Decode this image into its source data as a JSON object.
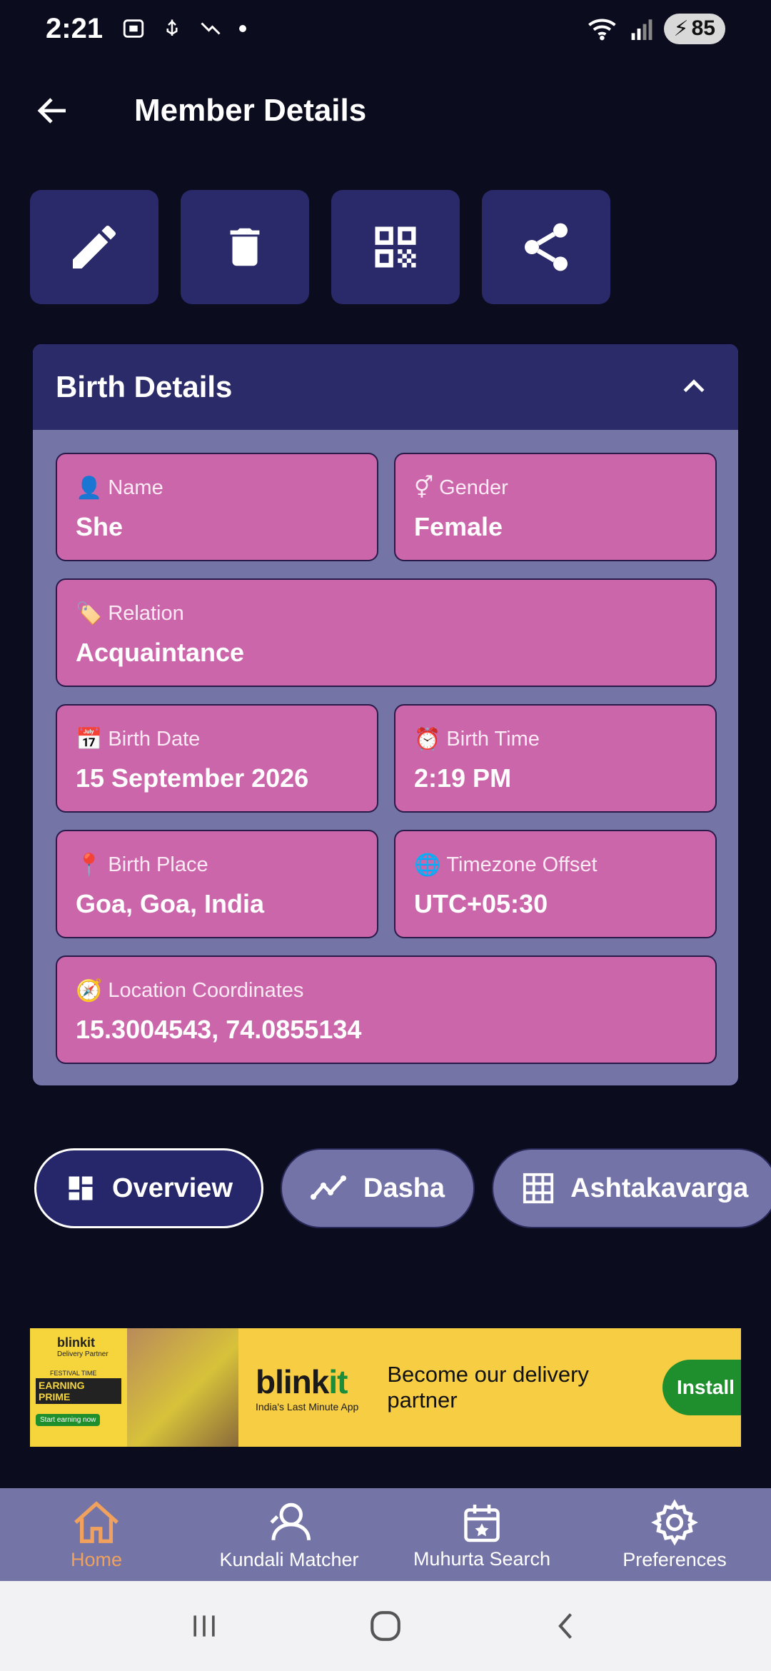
{
  "status_bar": {
    "time": "2:21",
    "battery": "85",
    "wifi_label": "5"
  },
  "header": {
    "title": "Member Details"
  },
  "actions": {
    "edit_icon": "pencil-icon",
    "delete_icon": "trash-icon",
    "qr_icon": "qr-code-icon",
    "share_icon": "share-icon"
  },
  "birth_details": {
    "title": "Birth Details",
    "fields": {
      "name": {
        "emoji": "👤",
        "label": "Name",
        "value": "She"
      },
      "gender": {
        "emoji": "⚥",
        "label": "Gender",
        "value": "Female"
      },
      "relation": {
        "emoji": "🏷️",
        "label": "Relation",
        "value": "Acquaintance"
      },
      "birth_date": {
        "emoji": "📅",
        "label": "Birth Date",
        "value": "15 September 2026"
      },
      "birth_time": {
        "emoji": "⏰",
        "label": "Birth Time",
        "value": "2:19 PM"
      },
      "birth_place": {
        "emoji": "📍",
        "label": "Birth Place",
        "value": "Goa, Goa, India"
      },
      "timezone": {
        "emoji": "🌐",
        "label": "Timezone Offset",
        "value": "UTC+05:30"
      },
      "coordinates": {
        "emoji": "🧭",
        "label": "Location Coordinates",
        "value": "15.3004543, 74.0855134"
      }
    }
  },
  "tabs": [
    {
      "label": "Overview",
      "icon": "dashboard-icon",
      "active": true
    },
    {
      "label": "Dasha",
      "icon": "trend-line-icon",
      "active": false
    },
    {
      "label": "Ashtakavarga",
      "icon": "grid-icon",
      "active": false
    }
  ],
  "ad": {
    "left_brand": "blinkit",
    "left_sub": "Delivery Partner",
    "left_promo1": "FESTIVAL TIME",
    "left_promo2": "EARNING PRIME",
    "left_cta": "Start earning now",
    "brand_a": "blink",
    "brand_b": "it",
    "brand_tag": "India's Last Minute App",
    "headline": "Become our delivery partner",
    "install": "Install"
  },
  "bottom_nav": [
    {
      "label": "Home",
      "icon": "home-icon",
      "active": true
    },
    {
      "label": "Kundali Matcher",
      "icon": "people-match-icon",
      "active": false
    },
    {
      "label": "Muhurta Search",
      "icon": "calendar-star-icon",
      "active": false
    },
    {
      "label": "Preferences",
      "icon": "gear-icon",
      "active": false
    }
  ],
  "colors": {
    "background": "#0c0c1f",
    "card_header": "#2b2b6a",
    "card_body": "#7474a6",
    "field": "#cc66aa",
    "active_nav": "#f0a15e"
  }
}
